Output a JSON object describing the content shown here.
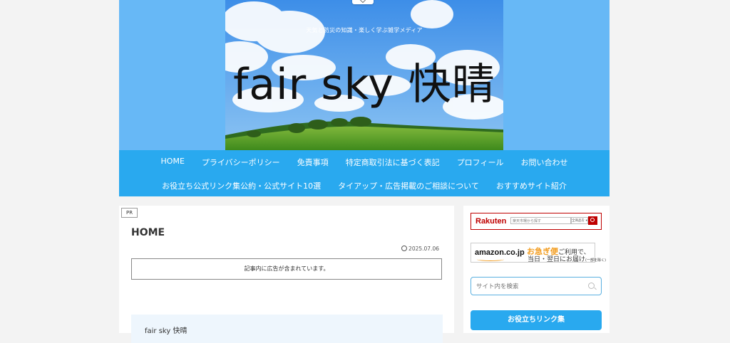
{
  "header": {
    "tagline": "天気と防災の知識・楽しく学ぶ雑学メディア",
    "site_title": "fair sky 快晴"
  },
  "nav": {
    "row1": [
      "HOME",
      "プライバシーポリシー",
      "免責事項",
      "特定商取引法に基づく表記",
      "プロフィール",
      "お問い合わせ"
    ],
    "row2": [
      "お役立ち公式リンク集公約・公式サイト10選",
      "タイアップ・広告掲載のご相談について",
      "おすすめサイト紹介"
    ]
  },
  "article": {
    "pr_badge": "PR",
    "title": "HOME",
    "date": "2025.07.06",
    "ad_notice": "記事内に広告が含まれています。",
    "toc_heading": "fair sky 快晴"
  },
  "sidebar": {
    "rakuten": {
      "logo": "Rakuten",
      "search_placeholder": "楽天市場から探す",
      "select_label": "全商品を ▾"
    },
    "amazon": {
      "logo": "amazon.co.jp",
      "line1_highlight": "お急ぎ便",
      "line1_rest": "ご利用で、",
      "line2": "当日・翌日にお届け",
      "line2_note": "(一部を除く)"
    },
    "search_placeholder": "サイト内を検索",
    "links_button": "お役立ちリンク集"
  },
  "colors": {
    "header_bg": "#67b8f6",
    "nav_bg": "#29a9ef",
    "rakuten_red": "#bf0000",
    "amazon_orange": "#f29c1f"
  }
}
